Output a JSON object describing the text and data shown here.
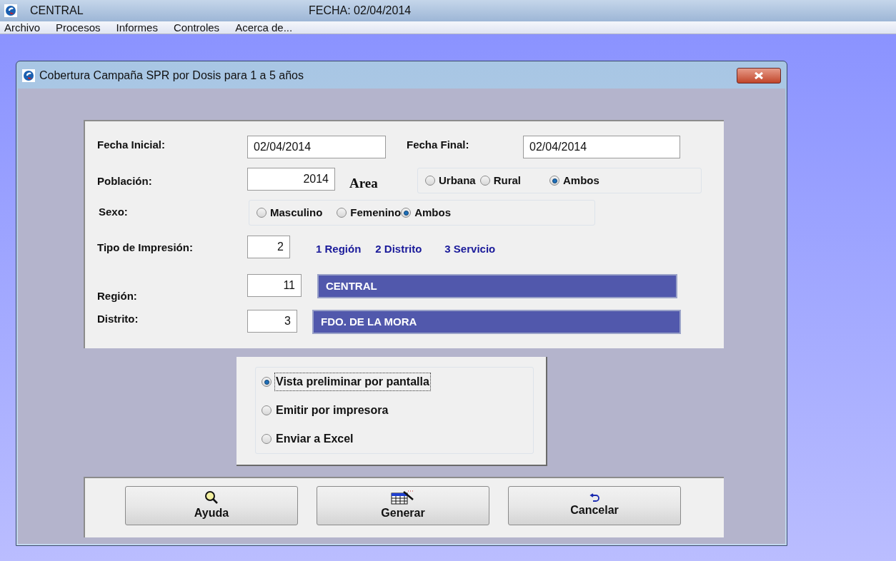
{
  "app": {
    "title": "CENTRAL",
    "date": "FECHA: 02/04/2014"
  },
  "menu": [
    "Archivo",
    "Procesos",
    "Informes",
    "Controles",
    "Acerca de..."
  ],
  "dialog": {
    "title": "Cobertura Campaña SPR por Dosis para 1 a 5 años",
    "fecha_inicial": {
      "label": "Fecha Inicial:",
      "value": "02/04/2014"
    },
    "fecha_final": {
      "label": "Fecha Final:",
      "value": "02/04/2014"
    },
    "poblacion": {
      "label": "Población:",
      "value": "2014"
    },
    "area": {
      "label": "Area",
      "options": [
        {
          "label": "Urbana",
          "selected": false
        },
        {
          "label": "Rural",
          "selected": false
        },
        {
          "label": "Ambos",
          "selected": true
        }
      ]
    },
    "sexo": {
      "label": "Sexo:",
      "options": [
        {
          "label": "Masculino",
          "selected": false
        },
        {
          "label": "Femenino",
          "selected": false
        },
        {
          "label": "Ambos",
          "selected": true
        }
      ]
    },
    "tipo_impresion": {
      "label": "Tipo de Impresión:",
      "value": "2",
      "legend": [
        "1 Región",
        "2 Distrito",
        "3 Servicio"
      ]
    },
    "region": {
      "label": "Región:",
      "code": "11",
      "name": "CENTRAL"
    },
    "distrito": {
      "label": "Distrito:",
      "code": "3",
      "name": "FDO. DE LA MORA"
    },
    "output_options": [
      {
        "label": "Vista preliminar por pantalla",
        "selected": true
      },
      {
        "label": "Emitir por impresora",
        "selected": false
      },
      {
        "label": "Enviar a Excel",
        "selected": false
      }
    ],
    "buttons": [
      {
        "label": "Ayuda",
        "kind": "help"
      },
      {
        "label": "Generar",
        "kind": "generate"
      },
      {
        "label": "Cancelar",
        "kind": "cancel"
      }
    ]
  }
}
